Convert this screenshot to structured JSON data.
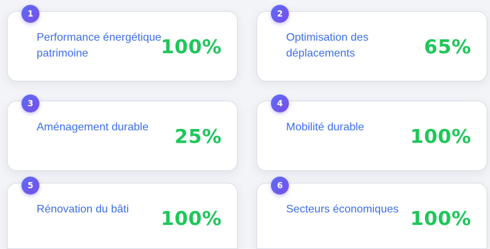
{
  "cards": [
    {
      "number": "1",
      "label": "Performance énergétique patrimoine",
      "value": "100%"
    },
    {
      "number": "2",
      "label": "Optimisation des déplacements",
      "value": "65%"
    },
    {
      "number": "3",
      "label": "Aménagement durable",
      "value": "25%"
    },
    {
      "number": "4",
      "label": "Mobilité durable",
      "value": "100%"
    },
    {
      "number": "5",
      "label": "Rénovation du bâti",
      "value": "100%"
    },
    {
      "number": "6",
      "label": "Secteurs économiques",
      "value": "100%"
    }
  ],
  "colors": {
    "badge_gradient_start": "#5b6df7",
    "badge_gradient_end": "#7a4de8",
    "label": "#3b6ee8",
    "value": "#1fc65a",
    "card_background": "#ffffff",
    "page_background": "#f3f4f7"
  }
}
